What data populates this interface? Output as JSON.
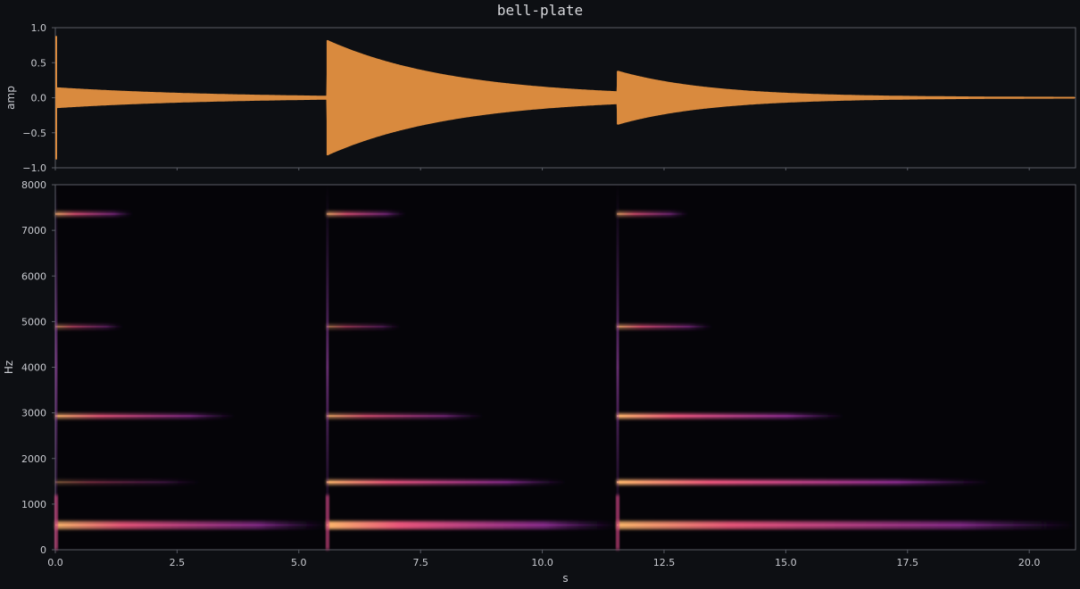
{
  "title": "bell-plate",
  "colors": {
    "background": "#0d0f13",
    "waveform": "#d98a3e",
    "spectrogram_background": "#050408",
    "axis": "#5a5d66",
    "text": "#c9cbd1"
  },
  "chart_data": [
    {
      "type": "area",
      "kind": "waveform",
      "ylabel": "amp",
      "ylim": [
        -1.0,
        1.0
      ],
      "xlim": [
        0,
        20.95
      ],
      "yticks": [
        1.0,
        0.5,
        0.0,
        -0.5,
        -1.0
      ],
      "ytick_labels": [
        "1.0",
        "0.5",
        "0.0",
        "−0.5",
        "−1.0"
      ],
      "grid": false,
      "events": [
        {
          "onset": 0.0,
          "peak": 0.88,
          "sustain_amp": 0.15,
          "decay_tau": 3.0,
          "end": 5.57
        },
        {
          "onset": 5.57,
          "peak": 0.82,
          "decay_tau": 2.6,
          "end": 11.53
        },
        {
          "onset": 11.53,
          "peak": 0.38,
          "decay_tau": 1.9,
          "end": 20.95
        }
      ]
    },
    {
      "type": "heatmap",
      "kind": "spectrogram",
      "xlabel": "s",
      "ylabel": "Hz",
      "xlim": [
        0,
        20.95
      ],
      "ylim": [
        0,
        8000
      ],
      "xticks": [
        0.0,
        2.5,
        5.0,
        7.5,
        10.0,
        12.5,
        15.0,
        17.5,
        20.0
      ],
      "xtick_labels": [
        "0.0",
        "2.5",
        "5.0",
        "7.5",
        "10.0",
        "12.5",
        "15.0",
        "17.5",
        "20.0"
      ],
      "yticks": [
        0,
        1000,
        2000,
        3000,
        4000,
        5000,
        6000,
        7000,
        8000
      ],
      "ytick_labels": [
        "0",
        "1000",
        "2000",
        "3000",
        "4000",
        "5000",
        "6000",
        "7000",
        "8000"
      ],
      "colormap": "magma",
      "grid": false,
      "onsets": [
        0.0,
        5.57,
        11.53
      ],
      "partials": [
        {
          "freq": 540,
          "segments": [
            [
              0.0,
              5.57,
              0.85
            ],
            [
              5.57,
              11.53,
              1.0
            ],
            [
              11.53,
              20.95,
              0.9
            ]
          ]
        },
        {
          "freq": 1480,
          "segments": [
            [
              0.0,
              3.0,
              0.25
            ],
            [
              5.57,
              10.5,
              0.8
            ],
            [
              11.53,
              19.2,
              0.95
            ]
          ]
        },
        {
          "freq": 2930,
          "segments": [
            [
              0.0,
              3.7,
              0.7
            ],
            [
              5.57,
              8.8,
              0.6
            ],
            [
              11.53,
              16.2,
              0.9
            ]
          ]
        },
        {
          "freq": 4890,
          "segments": [
            [
              0.0,
              1.4,
              0.4
            ],
            [
              5.57,
              7.1,
              0.35
            ],
            [
              11.53,
              13.5,
              0.55
            ]
          ]
        },
        {
          "freq": 7360,
          "segments": [
            [
              0.0,
              1.6,
              0.6
            ],
            [
              5.57,
              7.2,
              0.6
            ],
            [
              11.53,
              13.0,
              0.55
            ]
          ]
        }
      ]
    }
  ]
}
